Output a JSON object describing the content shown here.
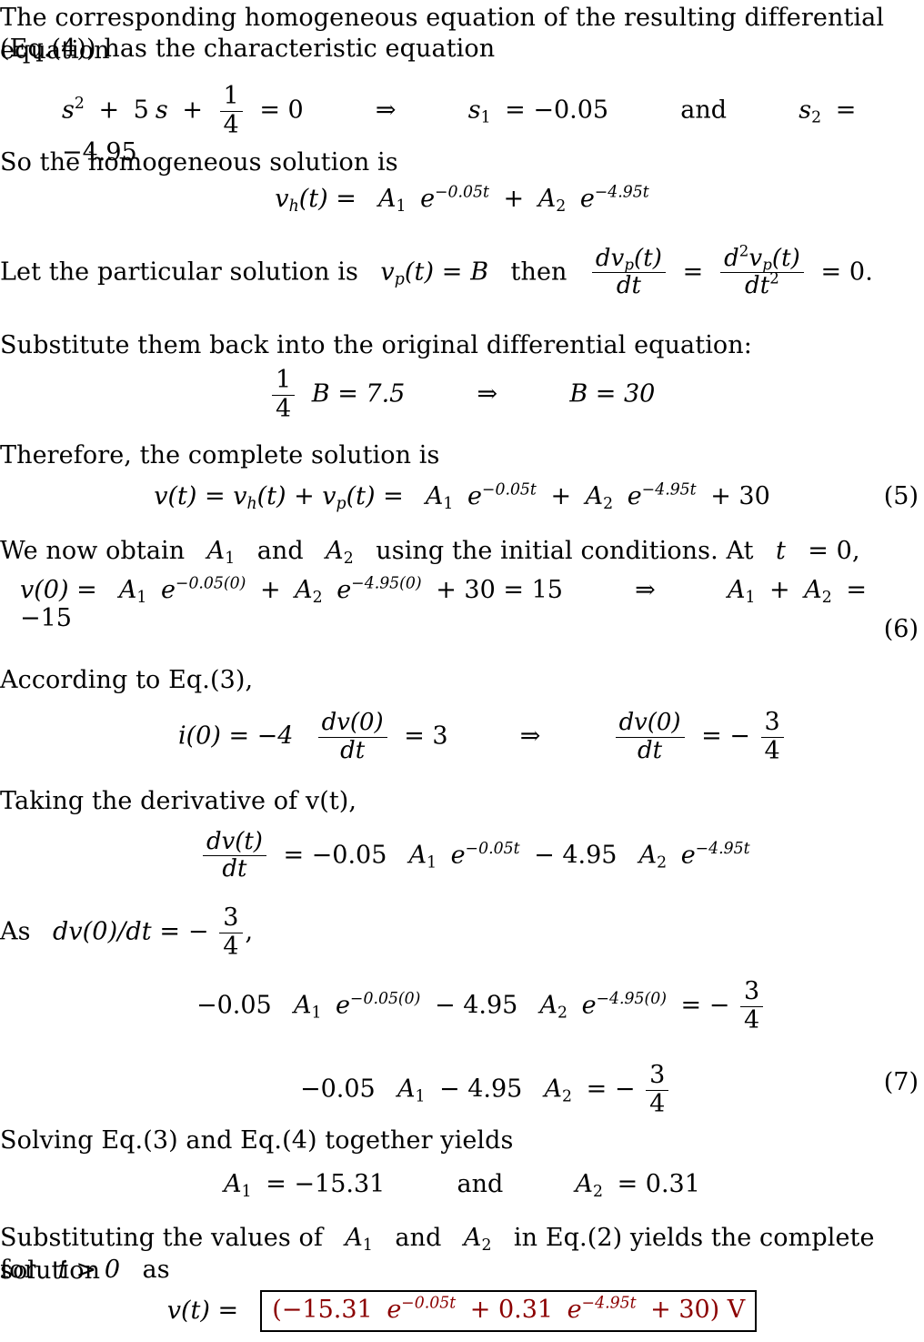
{
  "document": {
    "type": "math-solution",
    "subject": "Second-order RLC circuit step response",
    "text_color": "#000000",
    "answer_color": "#8b0000",
    "box_border_color": "#000000"
  },
  "lines": {
    "intro_1": "The corresponding homogeneous equation of the resulting differential equation",
    "intro_2": "(Eq.(4)) has the characteristic equation",
    "so_homogeneous": "So the homogeneous solution is",
    "let_particular_a": "Let the particular solution is",
    "let_particular_b": "then",
    "substitute_back": "Substitute them back into the original differential equation:",
    "therefore_complete": "Therefore, the complete solution is",
    "we_now_obtain_a": "We now obtain",
    "we_now_obtain_b": "and",
    "we_now_obtain_c": "using the initial conditions.  At",
    "we_now_obtain_d": "= 0,",
    "according_to": "According to Eq.(3),",
    "taking_derivative": "Taking the derivative of v(t),",
    "as_dvdt": "As",
    "solving_together": "Solving Eq.(3) and Eq.(4) together yields",
    "substituting_1": "Substituting the values of",
    "substituting_2": "and",
    "substituting_3": "in Eq.(2) yields the complete solution",
    "substituting_4": "for",
    "substituting_5": "as",
    "and_word": "and"
  },
  "math": {
    "char_eq": {
      "lhs_var": "s",
      "power": "2",
      "plus": "+",
      "coeff_5": "5",
      "var_s": "s",
      "frac_num": "1",
      "frac_den": "4",
      "equals": "= 0",
      "implies": "⇒",
      "root1_label": "s",
      "root1_sub": "1",
      "root1_value": "= −0.05",
      "root2_label": "s",
      "root2_sub": "2",
      "root2_value": "= −4.95"
    },
    "homogeneous_solution": {
      "v": "v",
      "v_sub": "h",
      "arg": "(t) =",
      "A1": "A",
      "A1_sub": "1",
      "e": "e",
      "exp1": "−0.05t",
      "plus": "+",
      "A2": "A",
      "A2_sub": "2",
      "exp2": "−4.95t"
    },
    "particular": {
      "vp": "v",
      "vp_sub": "p",
      "vp_arg": "(t) = B",
      "d_num": "dv",
      "d_num_sub": "p",
      "d_num_arg": "(t)",
      "d_den": "dt",
      "equals": "=",
      "d2_num_d": "d",
      "d2_num_sup": "2",
      "d2_num_v": "v",
      "d2_num_sub": "p",
      "d2_num_arg": "(t)",
      "d2_den": "dt",
      "d2_den_sup": "2",
      "result": "= 0."
    },
    "B_solve": {
      "frac_num": "1",
      "frac_den": "4",
      "lhs": "B = 7.5",
      "implies": "⇒",
      "rhs": "B = 30"
    },
    "complete_solution": {
      "lhs": "v(t) = v",
      "h_sub": "h",
      "mid": "(t) + v",
      "p_sub": "p",
      "mid2": "(t) =",
      "A1": "A",
      "A1_sub": "1",
      "e": "e",
      "exp1": "−0.05t",
      "plus": "+",
      "A2": "A",
      "A2_sub": "2",
      "exp2": "−4.95t",
      "plus30": "+ 30",
      "eqnum": "(5)"
    },
    "initial_condition": {
      "lhs": "v(0) =",
      "A1": "A",
      "A1_sub": "1",
      "e": "e",
      "exp1": "−0.05(0)",
      "plus": "+",
      "A2": "A",
      "A2_sub": "2",
      "exp2": "−4.95(0)",
      "tail": "+ 30 = 15",
      "implies": "⇒",
      "result_A1": "A",
      "result_A1_sub": "1",
      "result_plus": "+",
      "result_A2": "A",
      "result_A2_sub": "2",
      "result_value": "= −15",
      "eqnum": "(6)"
    },
    "i_zero": {
      "lhs": "i(0) = −4",
      "frac_num": "dv(0)",
      "frac_den": "dt",
      "equals3": "= 3",
      "implies": "⇒",
      "r_num": "dv(0)",
      "r_den": "dt",
      "r_eq": "= −",
      "r_frac_num": "3",
      "r_frac_den": "4"
    },
    "dvdt": {
      "num": "dv(t)",
      "den": "dt",
      "eq": "= −0.05",
      "A1": "A",
      "A1_sub": "1",
      "e": "e",
      "exp1": "−0.05t",
      "minus": "− 4.95",
      "A2": "A",
      "A2_sub": "2",
      "exp2": "−4.95t"
    },
    "as_dvdt": {
      "expr": "dv(0)/dt = −",
      "frac_num": "3",
      "frac_den": "4",
      "comma": ","
    },
    "eval_at_zero": {
      "lhs": "−0.05",
      "A1": "A",
      "A1_sub": "1",
      "e": "e",
      "exp1": "−0.05(0)",
      "minus": "− 4.95",
      "A2": "A",
      "A2_sub": "2",
      "exp2": "−4.95(0)",
      "eq": "= −",
      "frac_num": "3",
      "frac_den": "4"
    },
    "eq7": {
      "lhs": "−0.05",
      "A1": "A",
      "A1_sub": "1",
      "minus": "− 4.95",
      "A2": "A",
      "A2_sub": "2",
      "eq": "= −",
      "frac_num": "3",
      "frac_den": "4",
      "eqnum": "(7)"
    },
    "A_values": {
      "A1": "A",
      "A1_sub": "1",
      "A1_val": "= −15.31",
      "and": "and",
      "A2": "A",
      "A2_sub": "2",
      "A2_val": "= 0.31"
    },
    "final_answer": {
      "lhs": "v(t) =",
      "open": "(−15.31",
      "e": "e",
      "exp1": "−0.05t",
      "plus": "+ 0.31",
      "exp2": "−4.95t",
      "close": "+ 30) V"
    },
    "symbols": {
      "A1": "A",
      "A1_sub": "1",
      "A2": "A",
      "A2_sub": "2",
      "t": "t",
      "t_gt_0": "t > 0"
    }
  }
}
